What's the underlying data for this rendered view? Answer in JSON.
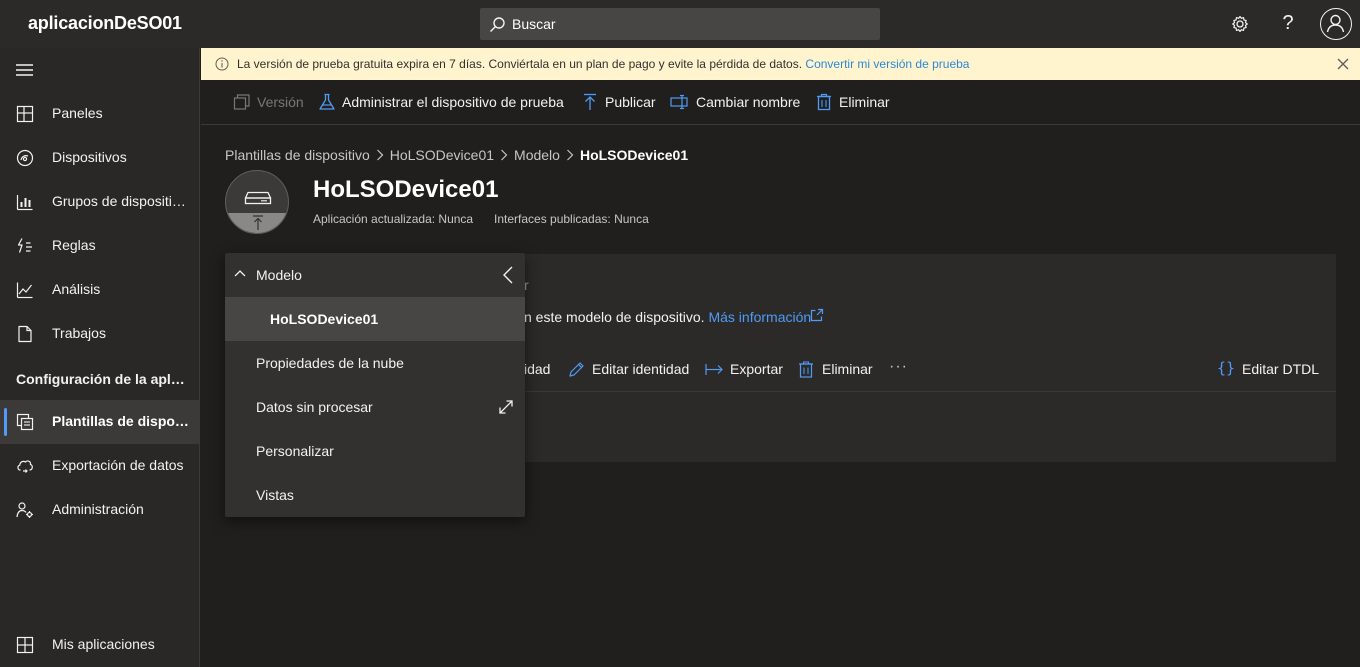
{
  "header": {
    "app_title": "aplicacionDeSO01",
    "search_placeholder": "Buscar",
    "settings_icon": "gear-icon",
    "help_label": "?",
    "profile_icon": "user-icon"
  },
  "sidebar": {
    "items": [
      {
        "label": "Paneles",
        "icon": "dashboard-icon"
      },
      {
        "label": "Dispositivos",
        "icon": "devices-icon"
      },
      {
        "label": "Grupos de dispositivos",
        "icon": "device-groups-icon"
      },
      {
        "label": "Reglas",
        "icon": "rules-icon"
      },
      {
        "label": "Análisis",
        "icon": "analytics-icon"
      },
      {
        "label": "Trabajos",
        "icon": "jobs-icon"
      }
    ],
    "section_label": "Configuración de la aplicación",
    "config_items": [
      {
        "label": "Plantillas de dispositivo",
        "icon": "device-templates-icon",
        "active": true
      },
      {
        "label": "Exportación de datos",
        "icon": "data-export-icon"
      },
      {
        "label": "Administración",
        "icon": "administration-icon"
      }
    ],
    "footer_item": {
      "label": "Mis aplicaciones",
      "icon": "my-apps-icon"
    }
  },
  "banner": {
    "text": "La versión de prueba gratuita expira en 7 días. Conviértala en un plan de pago y evite la pérdida de datos.",
    "link": "Convertir mi versión de prueba",
    "color": "#fff4ce"
  },
  "commands": {
    "version": "Versión",
    "manage_test_device": "Administrar el dispositivo de prueba",
    "publish": "Publicar",
    "rename": "Cambiar nombre",
    "delete": "Eliminar"
  },
  "breadcrumb": {
    "items": [
      "Plantillas de dispositivo",
      "HoLSODevice01",
      "Modelo"
    ],
    "current": "HoLSODevice01"
  },
  "template": {
    "title": "HoLSODevice01",
    "app_updated": "Aplicación actualizada: Nunca",
    "interfaces_published": "Interfaces publicadas: Nunca"
  },
  "card": {
    "heading_fragment": "r",
    "description_fragment": "n este modelo de dispositivo.",
    "more_info_link": "Más información",
    "tools": {
      "identity_fragment": "idad",
      "edit_identity": "Editar identidad",
      "export": "Exportar",
      "delete": "Eliminar",
      "more": "···",
      "edit_dtdl": "Editar DTDL"
    }
  },
  "tree": {
    "header": "Modelo",
    "items": [
      {
        "label": "HoLSODevice01",
        "selected": true
      },
      {
        "label": "Propiedades de la nube"
      },
      {
        "label": "Datos sin procesar"
      },
      {
        "label": "Personalizar"
      },
      {
        "label": "Vistas"
      }
    ]
  },
  "colors": {
    "accent": "#4f9bf5",
    "background": "#201f1e",
    "banner_link": "#2b88d8"
  }
}
